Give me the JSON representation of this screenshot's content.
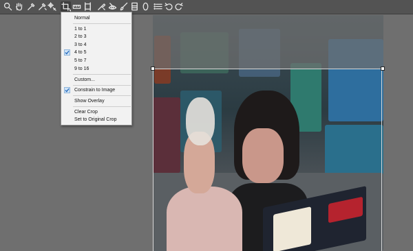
{
  "toolbar": {
    "tools": [
      {
        "icon": "zoom-icon"
      },
      {
        "icon": "hand-icon"
      },
      {
        "icon": "eyedropper-icon"
      },
      {
        "icon": "color-sampler-icon"
      },
      {
        "icon": "target-adjust-icon"
      },
      {
        "icon": "crop-icon",
        "active": true
      },
      {
        "icon": "straighten-icon"
      },
      {
        "icon": "transform-icon"
      },
      {
        "icon": "spot-removal-icon"
      },
      {
        "icon": "red-eye-icon"
      },
      {
        "icon": "adjustment-brush-icon"
      },
      {
        "icon": "graduated-filter-icon"
      },
      {
        "icon": "radial-filter-icon"
      },
      {
        "icon": "preferences-list-icon"
      },
      {
        "icon": "rotate-left-icon"
      },
      {
        "icon": "rotate-right-icon"
      }
    ]
  },
  "crop_menu": {
    "items": [
      {
        "label": "Normal",
        "checked": false
      },
      {
        "label": "1 to 1",
        "checked": false
      },
      {
        "label": "2 to 3",
        "checked": false
      },
      {
        "label": "3 to 4",
        "checked": false
      },
      {
        "label": "4 to 5",
        "checked": true
      },
      {
        "label": "5 to 7",
        "checked": false
      },
      {
        "label": "9 to 16",
        "checked": false
      },
      {
        "label": "Custom...",
        "checked": false
      },
      {
        "label": "Constrain to Image",
        "checked": true
      },
      {
        "label": "Show Overlay",
        "checked": false
      },
      {
        "label": "Clear Crop",
        "checked": false
      },
      {
        "label": "Set to Original Crop",
        "checked": false
      }
    ]
  },
  "colors": {
    "toolbar_bg": "#535353",
    "canvas_bg": "#6f6f6f",
    "menu_bg": "#f2f2f2",
    "check_accent": "#2a6fc1"
  }
}
